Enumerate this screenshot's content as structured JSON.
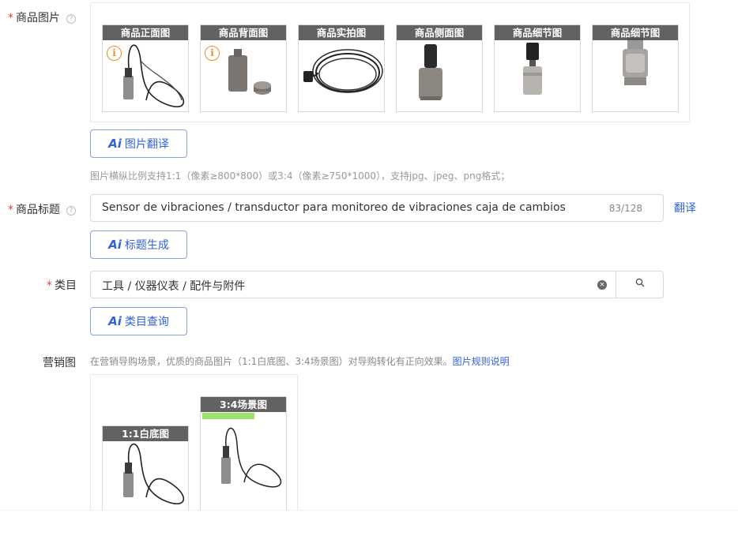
{
  "product_images": {
    "required_mark": "*",
    "label": "商品图片",
    "help_icon": "question-circle-icon",
    "thumbs": [
      {
        "caption": "商品正面图",
        "warning": true,
        "photo": "sensor-with-cable"
      },
      {
        "caption": "商品背面图",
        "warning": true,
        "photo": "sensor-parts"
      },
      {
        "caption": "商品实拍图",
        "warning": false,
        "photo": "coiled-cable"
      },
      {
        "caption": "商品侧面图",
        "warning": false,
        "photo": "sensor-connector"
      },
      {
        "caption": "商品细节图",
        "warning": false,
        "photo": "sensor-body"
      },
      {
        "caption": "商品细节图",
        "warning": false,
        "photo": "sensor-head"
      }
    ],
    "warning_icon": "info-warning-icon",
    "ai_button": {
      "mark": "Ai",
      "label": "图片翻译"
    },
    "hint": "图片横纵比例支持1:1（像素≥800*800）或3:4（像素≥750*1000），支持jpg、jpeg、png格式；"
  },
  "title": {
    "required_mark": "*",
    "label": "商品标题",
    "value": "Sensor de vibraciones / transductor para monitoreo de vibraciones   caja de cambios",
    "counter": "83/128",
    "translate_link": "翻译",
    "ai_button": {
      "mark": "Ai",
      "label": "标题生成"
    }
  },
  "category": {
    "required_mark": "*",
    "label": "类目",
    "value": "工具 / 仪器仪表 / 配件与附件",
    "clear_icon": "clear-circle-icon",
    "search_icon": "search-icon",
    "ai_button": {
      "mark": "Ai",
      "label": "类目查询"
    }
  },
  "marketing": {
    "label": "营销图",
    "hint": "在营销导购场景，优质的商品图片（1:1白底图、3:4场景图）对导购转化有正向效果。",
    "link": "图片规则说明",
    "thumbs": [
      {
        "caption": "1:1白底图"
      },
      {
        "caption": "3:4场景图"
      }
    ]
  },
  "colors": {
    "accent": "#3361d8",
    "required": "#e4393c",
    "warning": "#f08a24",
    "caption_bg": "#464646"
  }
}
